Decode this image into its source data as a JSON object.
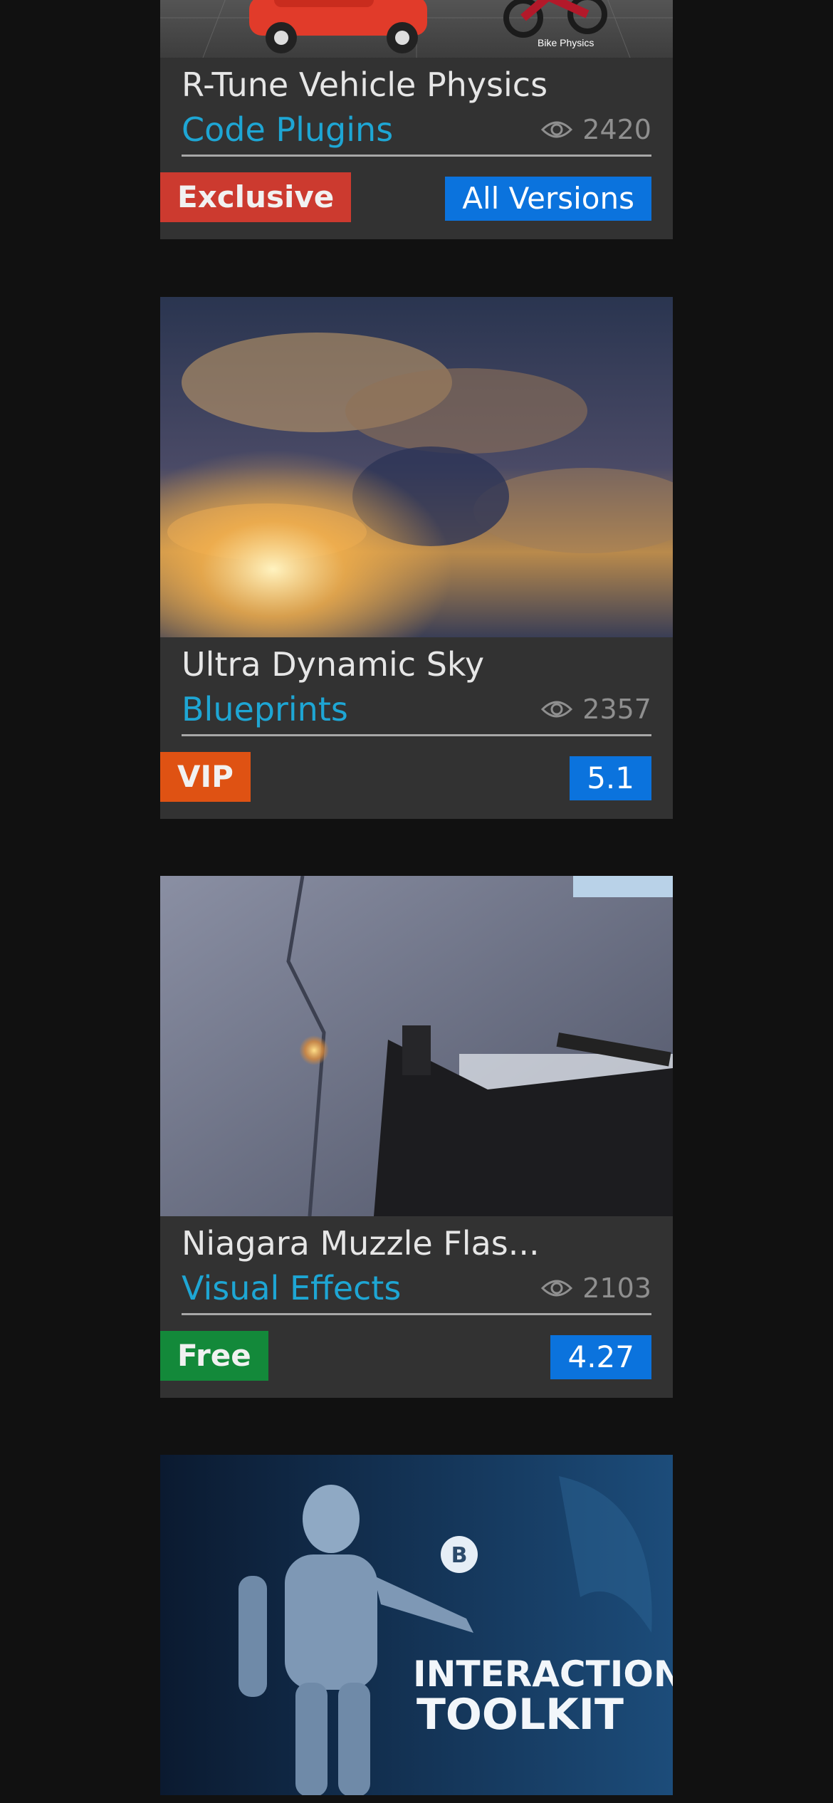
{
  "cards": [
    {
      "title": "R-Tune Vehicle Physics",
      "category": "Code Plugins",
      "views": "2420",
      "tag": "Exclusive",
      "tag_color": "#cc3a2f",
      "version": "All Versions",
      "thumb_caption": "Bike Physics"
    },
    {
      "title": "Ultra Dynamic Sky",
      "category": "Blueprints",
      "views": "2357",
      "tag": "VIP",
      "tag_color": "#df5213",
      "version": "5.1"
    },
    {
      "title": "Niagara Muzzle Flas...",
      "category": "Visual Effects",
      "views": "2103",
      "tag": "Free",
      "tag_color": "#13893a",
      "version": "4.27"
    },
    {
      "thumb_line1": "INTERACTION",
      "thumb_line2": "TOOLKIT",
      "thumb_badge": "B"
    }
  ],
  "colors": {
    "background": "#111111",
    "card": "#323232",
    "category": "#1ea6d4",
    "version_badge": "#0b73dd"
  }
}
